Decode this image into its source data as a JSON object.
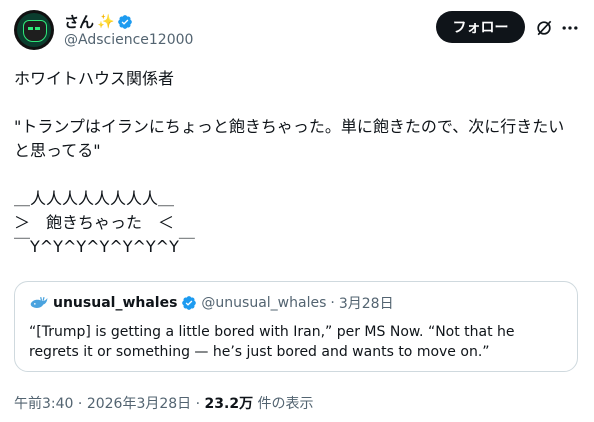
{
  "author": {
    "display_name": "さん",
    "handle": "@Adscience12000",
    "verified": true,
    "name_emoji": "✨"
  },
  "actions": {
    "follow_label": "フォロー",
    "grok_icon": "grok-icon",
    "more_icon": "more-icon"
  },
  "tweet": {
    "text": "ホワイトハウス関係者\n\n\"トランプはイランにちょっと飽きちゃった。単に飽きたので、次に行きたいと思ってる\"\n\n＿人人人人人人人人＿\n＞　飽きちゃった　＜\n￣Y^Y^Y^Y^Y^Y^Y￣"
  },
  "quote": {
    "display_name": "unusual_whales",
    "handle": "@unusual_whales",
    "date": "3月28日",
    "verified": true,
    "avatar_icon": "whale-icon",
    "text": "“[Trump] is getting a little bored with Iran,” per MS Now. “Not that he regrets it or something — he’s just bored and wants to move on.”"
  },
  "meta": {
    "time": "午前3:40",
    "date": "2026年3月28日",
    "views": "23.2万",
    "views_suffix": "件の表示"
  },
  "colors": {
    "verified_blue": "#1d9bf0",
    "text_primary": "#0f1419",
    "text_secondary": "#536471",
    "border": "#cfd9de",
    "follow_bg": "#0f1419"
  }
}
